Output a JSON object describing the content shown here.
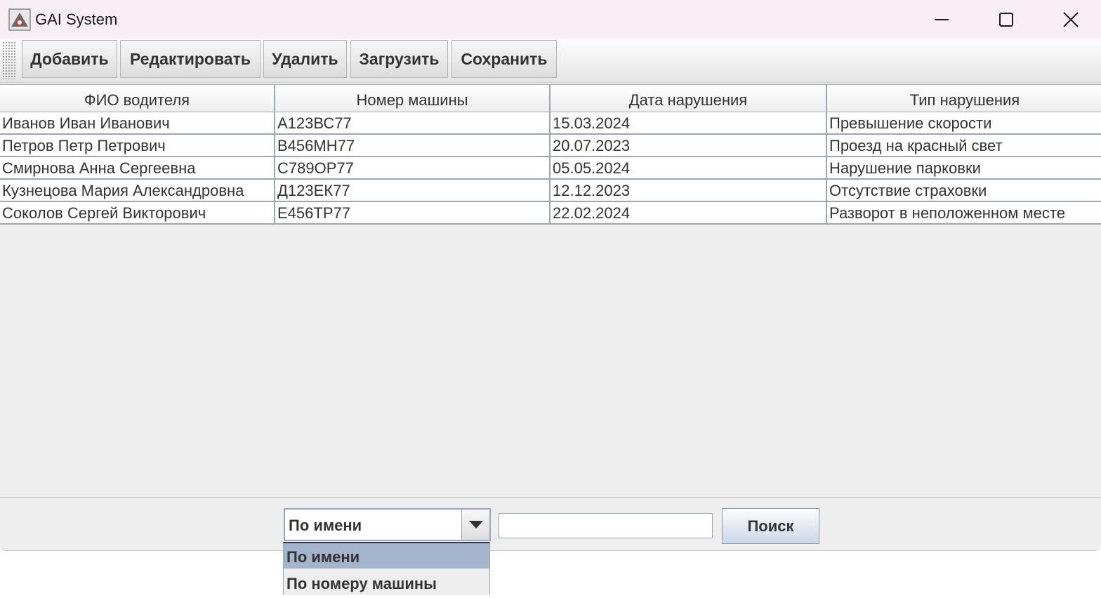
{
  "window": {
    "title": "GAI System"
  },
  "toolbar": {
    "buttons": [
      {
        "label": "Добавить"
      },
      {
        "label": "Редактировать"
      },
      {
        "label": "Удалить"
      },
      {
        "label": "Загрузить"
      },
      {
        "label": "Сохранить"
      }
    ]
  },
  "table": {
    "columns": [
      "ФИО водителя",
      "Номер машины",
      "Дата нарушения",
      "Тип нарушения"
    ],
    "rows": [
      [
        "Иванов Иван Иванович",
        "А123ВС77",
        "15.03.2024",
        "Превышение скорости"
      ],
      [
        "Петров Петр Петрович",
        "В456МН77",
        "20.07.2023",
        "Проезд на красный свет"
      ],
      [
        "Смирнова Анна Сергеевна",
        "С789ОР77",
        "05.05.2024",
        "Нарушение парковки"
      ],
      [
        "Кузнецова Мария Александровна",
        "Д123ЕК77",
        "12.12.2023",
        "Отсутствие страховки"
      ],
      [
        "Соколов Сергей Викторович",
        "Е456ТР77",
        "22.02.2024",
        "Разворот в неположенном месте"
      ]
    ]
  },
  "search": {
    "mode_selected": "По имени",
    "mode_options": [
      "По имени",
      "По номеру машины"
    ],
    "query_value": "",
    "button_label": "Поиск"
  },
  "colors": {
    "selection": "#a3b4cc",
    "grid": "#9aa6b4",
    "titlebar": "#f8eff5"
  }
}
